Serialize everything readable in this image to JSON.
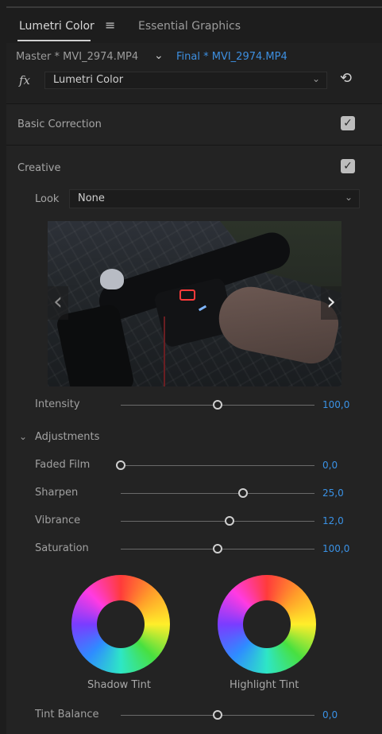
{
  "tabs": {
    "active": "Lumetri Color",
    "inactive": "Essential Graphics",
    "menu_icon": "hamburger-menu-icon"
  },
  "clip": {
    "master": "Master * MVI_2974.MP4",
    "final": "Final * MVI_2974.MP4",
    "fx_label": "fx",
    "effect": "Lumetri Color"
  },
  "sections": {
    "basic_correction": "Basic Correction",
    "creative": "Creative",
    "basic_checked": true,
    "creative_checked": true
  },
  "look": {
    "label": "Look",
    "value": "None"
  },
  "intensity": {
    "label": "Intensity",
    "value": "100,0",
    "fraction": 0.5
  },
  "adjustments": {
    "title": "Adjustments",
    "rows": [
      {
        "label": "Faded Film",
        "value": "0,0",
        "fraction": 0.0
      },
      {
        "label": "Sharpen",
        "value": "25,0",
        "fraction": 0.63
      },
      {
        "label": "Vibrance",
        "value": "12,0",
        "fraction": 0.56
      },
      {
        "label": "Saturation",
        "value": "100,0",
        "fraction": 0.5
      }
    ]
  },
  "wheels": {
    "shadow": "Shadow Tint",
    "highlight": "Highlight Tint"
  },
  "tint_balance": {
    "label": "Tint Balance",
    "value": "0,0",
    "fraction": 0.5
  },
  "colors": {
    "accent_blue": "#3a92e6",
    "panel_bg": "#232323"
  }
}
